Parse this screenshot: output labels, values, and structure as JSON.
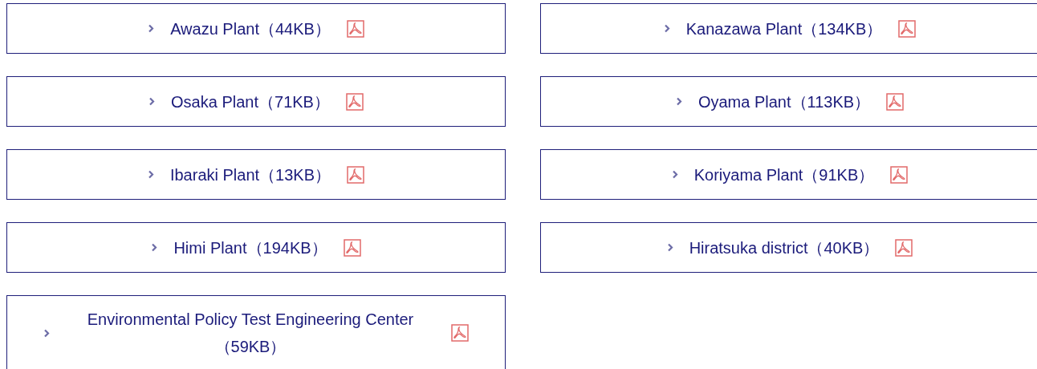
{
  "links": [
    {
      "label": "Awazu Plant（44KB）"
    },
    {
      "label": "Kanazawa Plant（134KB）"
    },
    {
      "label": "Osaka Plant（71KB）"
    },
    {
      "label": "Oyama Plant（113KB）"
    },
    {
      "label": "Ibaraki Plant（13KB）"
    },
    {
      "label": "Koriyama Plant（91KB）"
    },
    {
      "label": "Himi Plant（194KB）"
    },
    {
      "label": "Hiratsuka district（40KB）"
    },
    {
      "label": "Environmental Policy Test Engineering Center（59KB）"
    }
  ]
}
